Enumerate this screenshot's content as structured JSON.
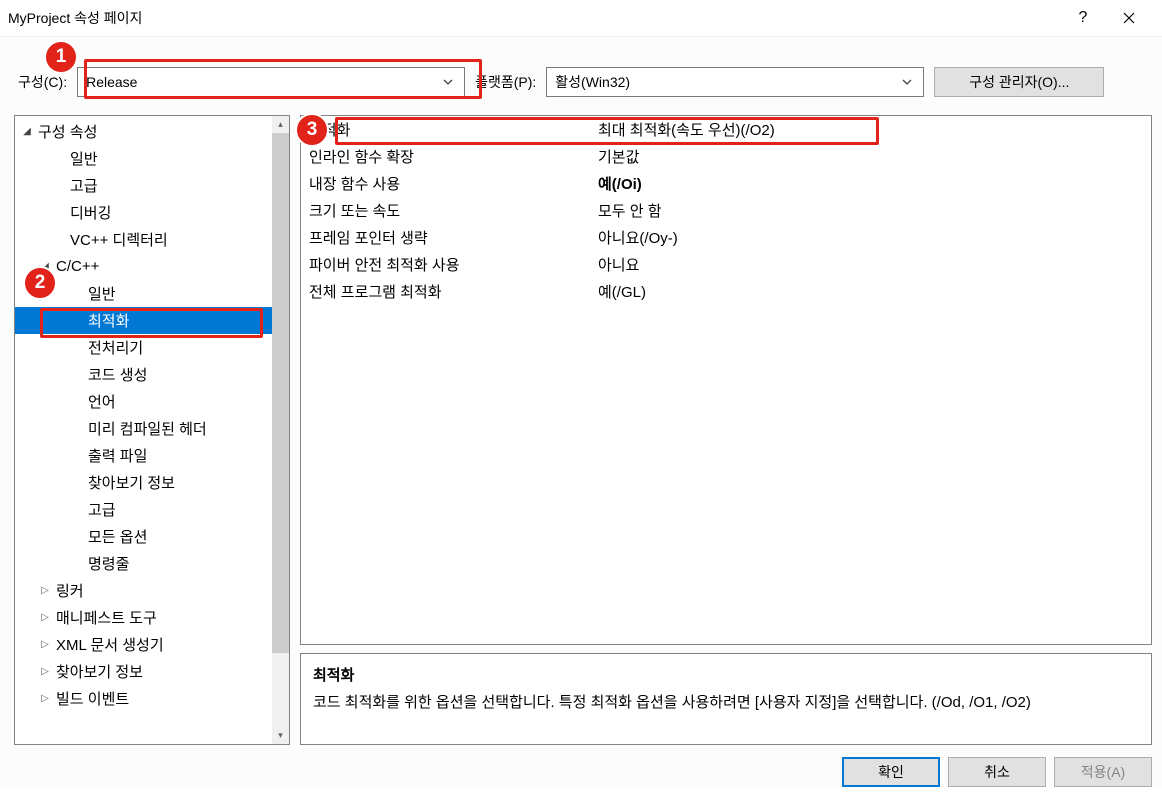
{
  "titlebar": {
    "title": "MyProject 속성 페이지"
  },
  "top": {
    "config_label": "구성(C):",
    "config_value": "Release",
    "platform_label": "플랫폼(P):",
    "platform_value": "활성(Win32)",
    "config_mgr_btn": "구성 관리자(O)..."
  },
  "steps": {
    "one": "1",
    "two": "2",
    "three": "3"
  },
  "tree": {
    "root": "구성 속성",
    "items_l1": {
      "general": "일반",
      "advanced": "고급",
      "debugging": "디버깅",
      "vcdirs": "VC++ 디렉터리"
    },
    "ccpp": "C/C++",
    "ccpp_items": {
      "general": "일반",
      "optimization": "최적화",
      "preprocessor": "전처리기",
      "codegen": "코드 생성",
      "language": "언어",
      "precompiled": "미리 컴파일된 헤더",
      "outputfiles": "출력 파일",
      "browseinfo": "찾아보기 정보",
      "advanced": "고급",
      "alloptions": "모든 옵션",
      "cmdline": "명령줄"
    },
    "others": {
      "linker": "링커",
      "manifest": "매니페스트 도구",
      "xmldocgen": "XML 문서 생성기",
      "browseinfo": "찾아보기 정보",
      "buildevents": "빌드 이벤트"
    }
  },
  "props": [
    {
      "key": "최적화",
      "val": "최대 최적화(속도 우선)(/O2)",
      "bold": false
    },
    {
      "key": "인라인 함수 확장",
      "val": "기본값",
      "bold": false
    },
    {
      "key": "내장 함수 사용",
      "val": "예(/Oi)",
      "bold": true
    },
    {
      "key": "크기 또는 속도",
      "val": "모두 안 함",
      "bold": false
    },
    {
      "key": "프레임 포인터 생략",
      "val": "아니요(/Oy-)",
      "bold": false
    },
    {
      "key": "파이버 안전 최적화 사용",
      "val": "아니요",
      "bold": false
    },
    {
      "key": "전체 프로그램 최적화",
      "val": "예(/GL)",
      "bold": false
    }
  ],
  "desc": {
    "title": "최적화",
    "body": "코드 최적화를 위한 옵션을 선택합니다. 특정 최적화 옵션을 사용하려면 [사용자 지정]을 선택합니다. (/Od, /O1, /O2)"
  },
  "footer": {
    "ok": "확인",
    "cancel": "취소",
    "apply": "적용(A)"
  }
}
